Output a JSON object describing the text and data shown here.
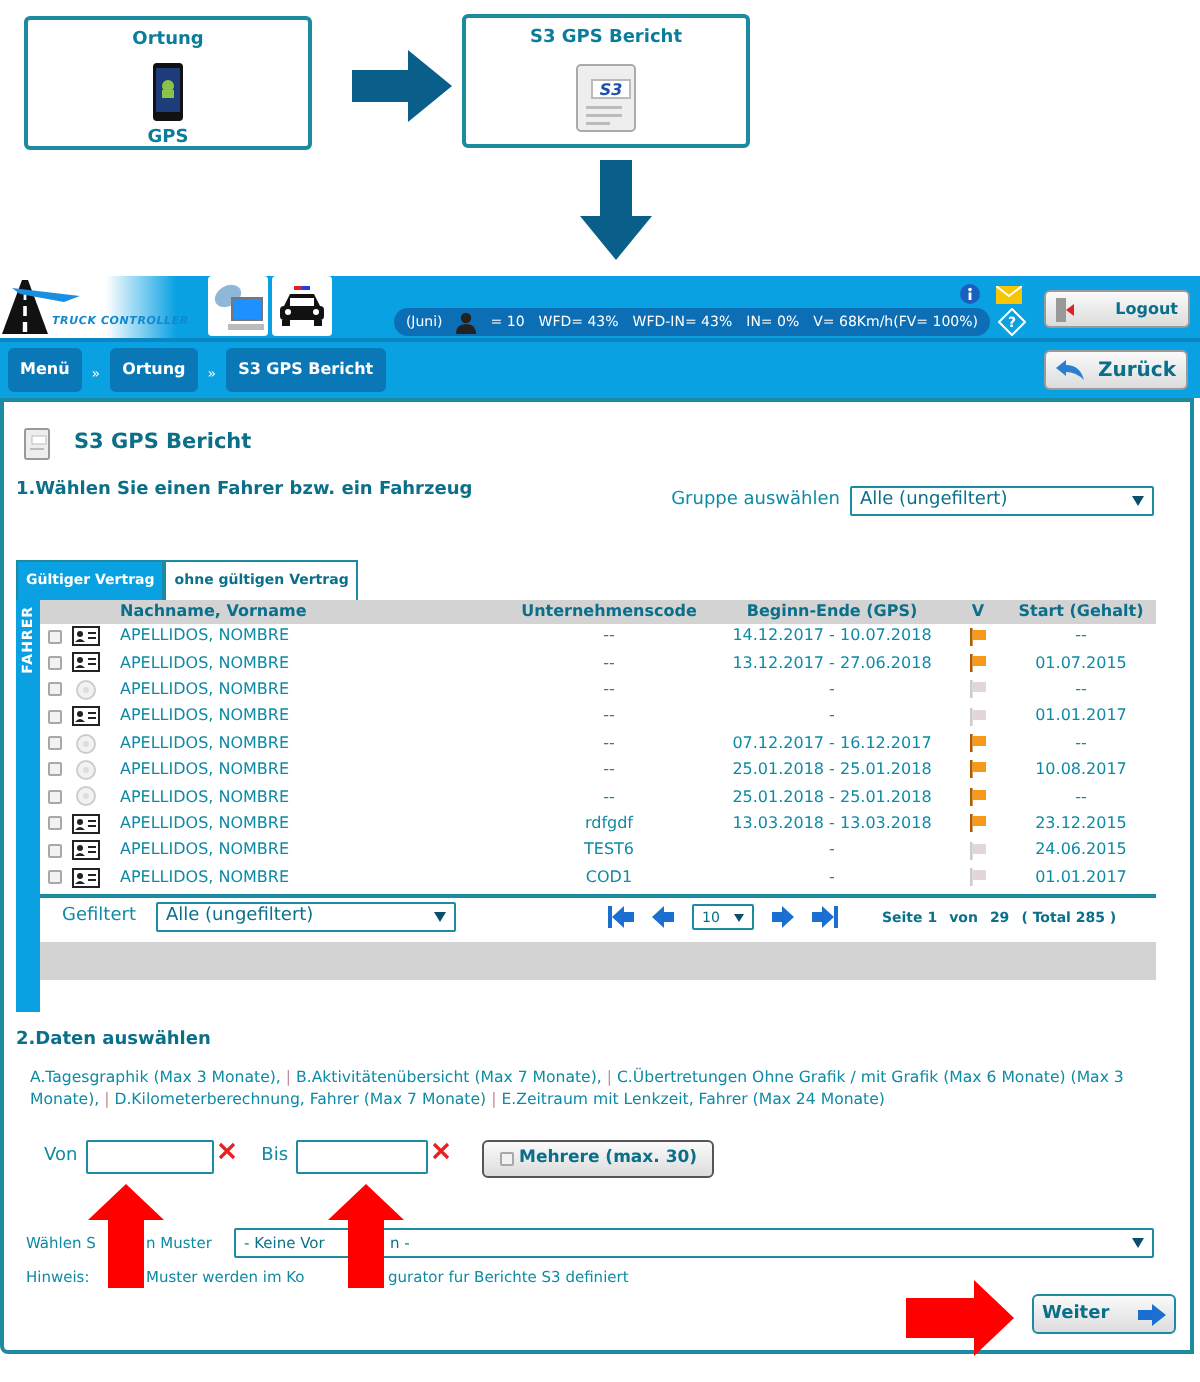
{
  "flow": {
    "boxes": [
      {
        "title": "Ortung",
        "caption": "GPS",
        "kind": "phone"
      },
      {
        "title": "S3 GPS Bericht",
        "kind": "document",
        "icon_text": "S3"
      }
    ]
  },
  "header": {
    "logo": "TRUCK CONTROLLER",
    "status": [
      "(Juni)",
      "= 10",
      "WFD= 43%",
      "WFD-IN= 43%",
      "IN= 0%",
      "V= 68Km/h(FV= 100%)"
    ],
    "help": "?",
    "logout": "Logout"
  },
  "breadcrumb": {
    "items": [
      "Menü",
      "Ortung",
      "S3 GPS Bericht"
    ],
    "separator": "»",
    "back": "Zurück"
  },
  "page_title": "S3 GPS Bericht",
  "section_1": {
    "heading": "1.Wählen Sie einen Fahrer bzw. ein Fahrzeug",
    "group_label": "Gruppe auswählen",
    "group_value": "Alle (ungefiltert)"
  },
  "tabs": [
    {
      "label": "Gültiger Vertrag",
      "selected": true
    },
    {
      "label": "ohne gültigen Vertrag",
      "selected": false
    }
  ],
  "side_label": "FAHRER",
  "table": {
    "columns": [
      "Nachname, Vorname",
      "Unternehmenscode",
      "Beginn-Ende (GPS)",
      "V",
      "Start (Gehalt)"
    ],
    "rows": [
      {
        "checked": false,
        "kind": "card",
        "name": "APELLIDOS, NOMBRE",
        "code": "--",
        "period": "14.12.2017 - 10.07.2018",
        "v_active": true,
        "start": "--"
      },
      {
        "checked": false,
        "kind": "card",
        "name": "APELLIDOS, NOMBRE",
        "code": "--",
        "period": "13.12.2017 - 27.06.2018",
        "v_active": true,
        "start": "01.07.2015"
      },
      {
        "checked": false,
        "kind": "disc",
        "name": "APELLIDOS, NOMBRE",
        "code": "--",
        "period": "-",
        "v_active": false,
        "start": "--"
      },
      {
        "checked": false,
        "kind": "card",
        "name": "APELLIDOS, NOMBRE",
        "code": "--",
        "period": "-",
        "v_active": false,
        "start": "01.01.2017"
      },
      {
        "checked": false,
        "kind": "disc",
        "name": "APELLIDOS, NOMBRE",
        "code": "--",
        "period": "07.12.2017 - 16.12.2017",
        "v_active": true,
        "start": "--"
      },
      {
        "checked": false,
        "kind": "disc",
        "name": "APELLIDOS, NOMBRE",
        "code": "--",
        "period": "25.01.2018 - 25.01.2018",
        "v_active": true,
        "start": "10.08.2017"
      },
      {
        "checked": false,
        "kind": "disc",
        "name": "APELLIDOS, NOMBRE",
        "code": "--",
        "period": "25.01.2018 - 25.01.2018",
        "v_active": true,
        "start": "--"
      },
      {
        "checked": false,
        "kind": "card",
        "name": "APELLIDOS, NOMBRE",
        "code": "rdfgdf",
        "period": "13.03.2018 - 13.03.2018",
        "v_active": true,
        "start": "23.12.2015"
      },
      {
        "checked": false,
        "kind": "card",
        "name": "APELLIDOS, NOMBRE",
        "code": "TEST6",
        "period": "-",
        "v_active": false,
        "start": "24.06.2015"
      },
      {
        "checked": false,
        "kind": "card",
        "name": "APELLIDOS, NOMBRE",
        "code": "COD1",
        "period": "-",
        "v_active": false,
        "start": "01.01.2017"
      }
    ]
  },
  "filter": {
    "label": "Gefiltert",
    "value": "Alle (ungefiltert)"
  },
  "pager": {
    "page_size": "10",
    "page": "Seite 1",
    "of": "von",
    "pages": "29",
    "total": "( Total 285 )"
  },
  "section_2": {
    "heading": "2.Daten auswählen",
    "options": [
      "A.Tagesgraphik (Max 3 Monate),",
      "B.Aktivitätenübersicht (Max 7 Monate),",
      "C.Übertretungen Ohne Grafik / mit Grafik (Max 6 Monate) (Max 3 Monate),",
      "D.Kilometerberechnung, Fahrer (Max 7 Monate)",
      "E.Zeitraum mit Lenkzeit, Fahrer (Max 24 Monate)"
    ],
    "divider": "|"
  },
  "dates": {
    "from_label": "Von",
    "to_label": "Bis",
    "multi": {
      "label": "Mehrere (max. 30)",
      "checked": false
    }
  },
  "pattern": {
    "label_parts": [
      "Wählen S",
      "n Muster"
    ],
    "select_parts": [
      "- Keine Vor",
      "n -"
    ]
  },
  "hint_parts": [
    "Hinweis:",
    "Muster werden im Ko",
    "gurator fur Berichte S3 definiert"
  ],
  "next": "Weiter"
}
